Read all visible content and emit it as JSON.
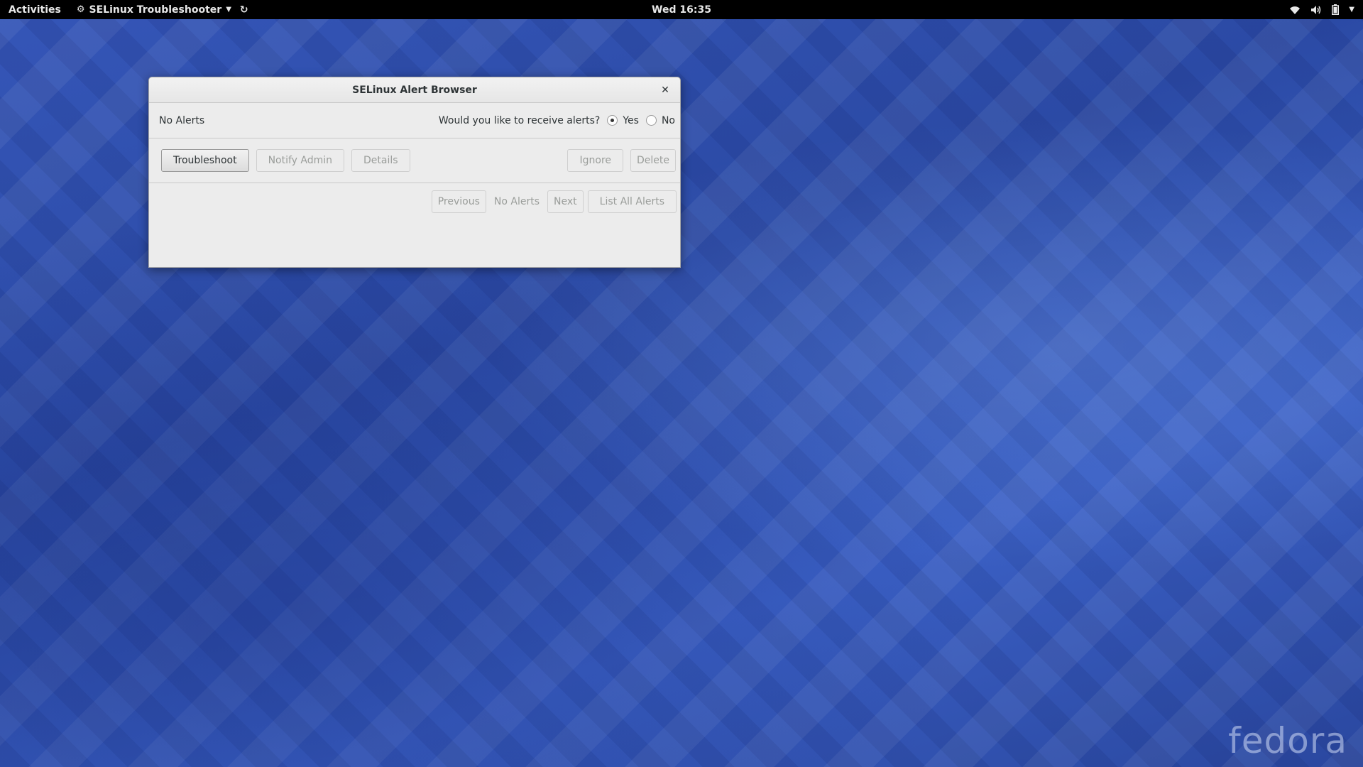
{
  "topbar": {
    "activities": "Activities",
    "app_name": "SELinux Troubleshooter",
    "clock": "Wed 16:35"
  },
  "dialog": {
    "title": "SELinux Alert Browser",
    "close_glyph": "✕",
    "status": "No Alerts",
    "question": "Would you like to receive alerts?",
    "radio_yes": "Yes",
    "radio_no": "No",
    "selected": "Yes",
    "buttons": {
      "troubleshoot": "Troubleshoot",
      "notify_admin": "Notify Admin",
      "details": "Details",
      "ignore": "Ignore",
      "delete": "Delete"
    },
    "nav": {
      "previous": "Previous",
      "count": "No Alerts",
      "next": "Next",
      "list_all": "List All Alerts"
    }
  },
  "logo": "fedora",
  "icons": {
    "app": "gear-icon",
    "wifi": "wifi-icon",
    "volume": "volume-icon",
    "battery": "battery-icon",
    "system_menu": "chevron-down-icon"
  },
  "colors": {
    "topbar_bg": "#000000",
    "desktop_bg": "#2d4fae",
    "dialog_bg": "#ececec"
  }
}
